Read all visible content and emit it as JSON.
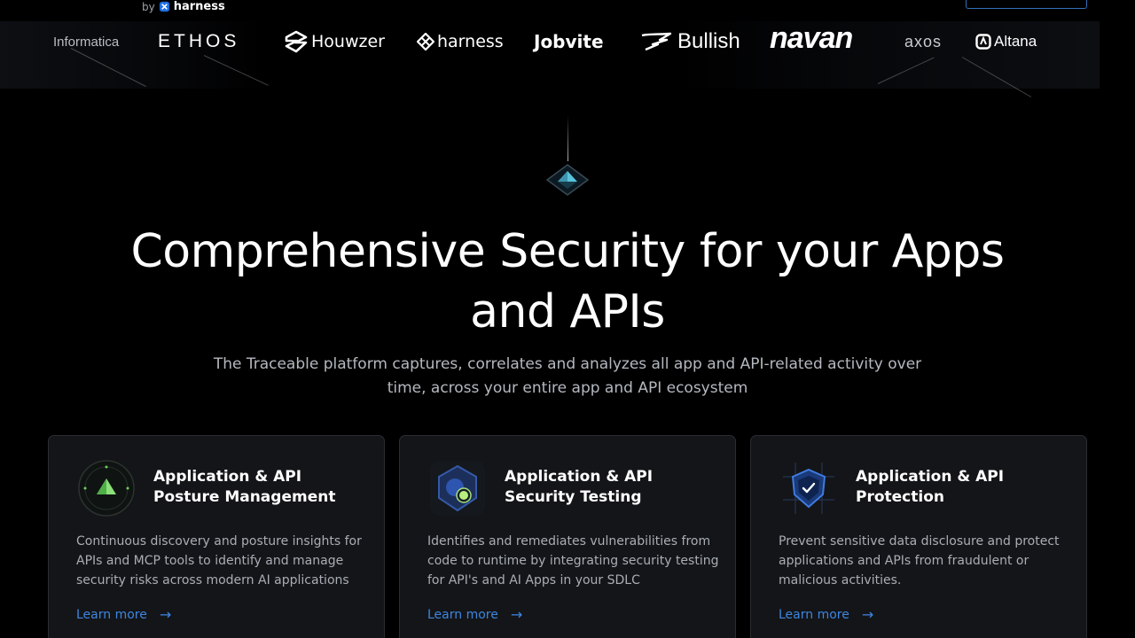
{
  "topbar": {
    "by_label": "by",
    "brand_label": "harness"
  },
  "logos": {
    "informatica": "Informatica",
    "ethos": "ETHOS",
    "houwzer": "Houwzer",
    "harness": "harness",
    "jobvite": "Jobvite",
    "bullish": "Bullish",
    "navan": "navan",
    "axos": "axos",
    "altana": "Altana"
  },
  "hero": {
    "title": "Comprehensive Security for your Apps and APIs",
    "subtitle": "The Traceable platform captures, correlates and analyzes all app and API-related activity over time, across your entire app and API ecosystem"
  },
  "cards": [
    {
      "title": "Application & API Posture Management",
      "description": "Continuous discovery and posture insights for APIs and MCP tools to identify and manage security risks across modern AI applications",
      "link": "Learn more",
      "icon": "posture-icon"
    },
    {
      "title": "Application & API Security Testing",
      "description": "Identifies and remediates vulnerabilities from code to runtime by integrating security testing for API's and AI Apps in your SDLC",
      "link": "Learn more",
      "icon": "security-testing-icon"
    },
    {
      "title": "Application & API Protection",
      "description": "Prevent sensitive data disclosure and protect applications and APIs from fraudulent or malicious activities.",
      "link": "Learn more",
      "icon": "shield-check-icon"
    }
  ],
  "colors": {
    "link": "#3d86e0",
    "card_bg": "#141518",
    "accent_cta_border": "#2f6fb8"
  }
}
